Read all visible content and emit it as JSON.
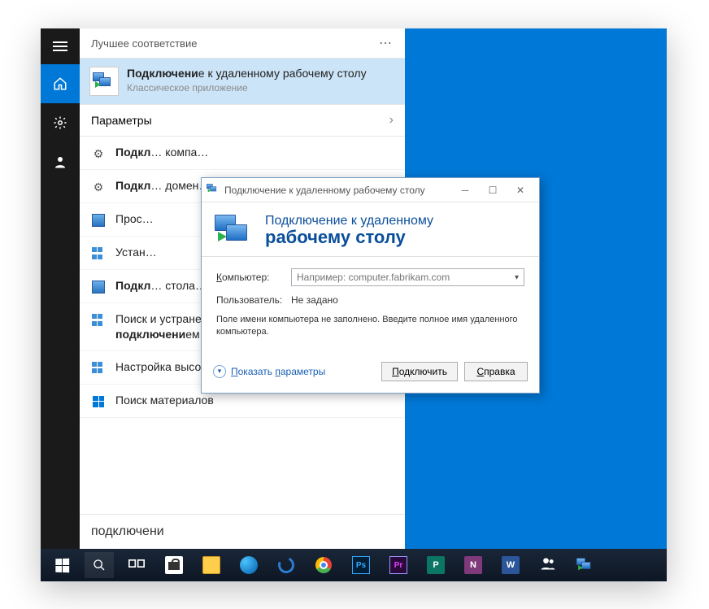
{
  "colors": {
    "accent": "#0078d7",
    "desktop": "#0078d7"
  },
  "leftbar": {
    "items": [
      {
        "name": "hamburger"
      },
      {
        "name": "home",
        "active": true
      },
      {
        "name": "settings"
      },
      {
        "name": "people"
      }
    ]
  },
  "startmenu": {
    "header": "Лучшее соответствие",
    "best_match": {
      "title_prefix_bold": "Подключени",
      "title_rest": "е к удаленному рабочему столу",
      "subtitle": "Классическое приложение"
    },
    "params_label": "Параметры",
    "results": [
      {
        "icon": "gear",
        "html": "<b>Подкл</b>… компа…"
      },
      {
        "icon": "gear",
        "html": "<b>Подкл</b>… домен…"
      },
      {
        "icon": "netset",
        "html": "Прос…"
      },
      {
        "icon": "netset2",
        "html": "Устан…"
      },
      {
        "icon": "netset",
        "html": "<b>Подкл</b>… стола…"
      },
      {
        "icon": "netset2",
        "html": "Поиск и устранение проблем с сетью и <b>подключени</b>ем"
      },
      {
        "icon": "netset2",
        "html": "Настройка высокоскоростного <b>подключения</b>"
      },
      {
        "icon": "winlogo",
        "html": "Поиск материалов"
      }
    ],
    "search_value": "подключени"
  },
  "dialog": {
    "title": "Подключение к удаленному рабочему столу",
    "header_line1": "Подключение к удаленному",
    "header_line2": "рабочему столу",
    "computer_label": "Компьютер:",
    "computer_label_ul": "К",
    "computer_placeholder": "Например: computer.fabrikam.com",
    "user_label": "Пользователь:",
    "user_value": "Не задано",
    "hint": "Поле имени компьютера не заполнено. Введите полное имя удаленного компьютера.",
    "show_params": "Показать параметры",
    "show_params_ul": "П",
    "connect_btn": "Подключить",
    "connect_ul": "П",
    "help_btn": "Справка",
    "help_ul": "С"
  },
  "taskbar": {
    "apps": [
      {
        "name": "start",
        "type": "winlogo"
      },
      {
        "name": "search",
        "type": "search"
      },
      {
        "name": "taskview",
        "type": "taskview"
      },
      {
        "name": "store",
        "type": "store"
      },
      {
        "name": "explorer",
        "type": "explorer"
      },
      {
        "name": "edge",
        "type": "edge"
      },
      {
        "name": "ie",
        "type": "ie"
      },
      {
        "name": "chrome",
        "type": "chrome"
      },
      {
        "name": "photoshop",
        "type": "adobe",
        "label": "Ps",
        "cls": "ps"
      },
      {
        "name": "premiere",
        "type": "adobe",
        "label": "Pr",
        "cls": "pr"
      },
      {
        "name": "publisher",
        "type": "office",
        "label": "P",
        "cls": "pub"
      },
      {
        "name": "onenote",
        "type": "office",
        "label": "N",
        "cls": "onenote"
      },
      {
        "name": "word",
        "type": "office",
        "label": "W",
        "cls": "word"
      },
      {
        "name": "people",
        "type": "people"
      },
      {
        "name": "rdp",
        "type": "rdp"
      }
    ]
  }
}
